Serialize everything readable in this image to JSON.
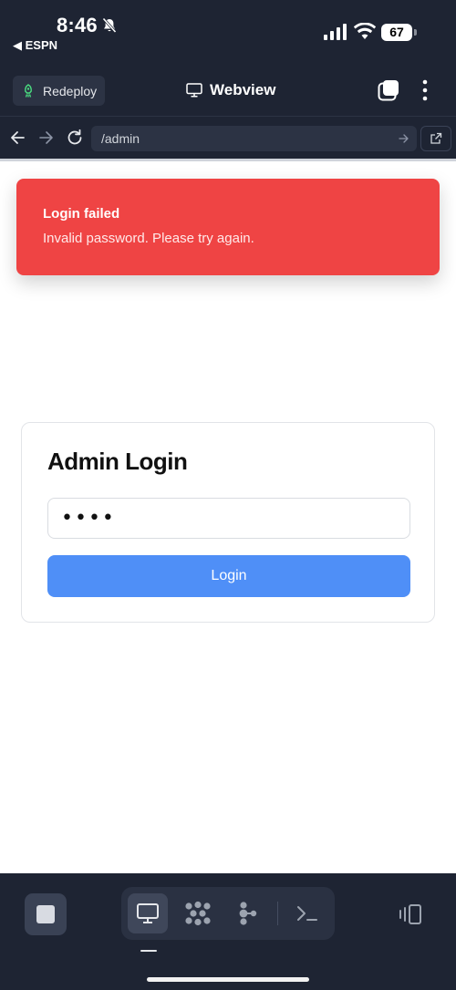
{
  "status_bar": {
    "time": "8:46",
    "back_app": "◀ ESPN",
    "battery": "67"
  },
  "header": {
    "redeploy_label": "Redeploy",
    "title": "Webview"
  },
  "url_bar": {
    "url": "/admin"
  },
  "toast": {
    "title": "Login failed",
    "message": "Invalid password. Please try again."
  },
  "login": {
    "title": "Admin Login",
    "password_value": "••••",
    "button_label": "Login"
  },
  "colors": {
    "toast_bg": "#ef4444",
    "button_bg": "#4f8ff7",
    "chrome_bg": "#1e2433"
  },
  "icons": [
    "bell-slash-icon",
    "signal-icon",
    "wifi-icon",
    "battery-icon",
    "rocket-icon",
    "monitor-icon",
    "tabs-icon",
    "more-vertical-icon",
    "back-arrow-icon",
    "forward-arrow-icon",
    "reload-icon",
    "go-arrow-icon",
    "external-link-icon",
    "stop-icon",
    "cluster-icon",
    "branch-icon",
    "terminal-icon",
    "split-view-icon"
  ]
}
